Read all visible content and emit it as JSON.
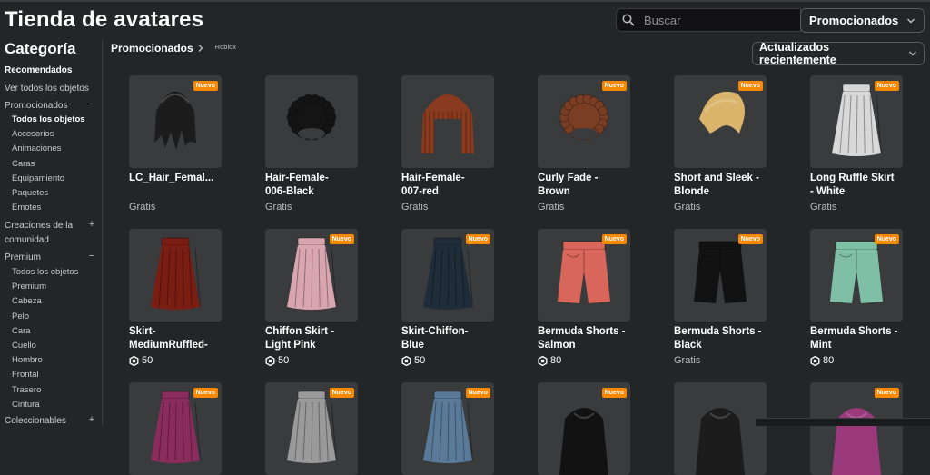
{
  "page": {
    "title": "Tienda de avatares"
  },
  "search": {
    "placeholder": "Buscar"
  },
  "category_select": {
    "value": "Promocionados"
  },
  "breadcrumb": {
    "main": "Promocionados",
    "sub": "Roblox"
  },
  "sort_select": {
    "value": "Actualizados recientemente"
  },
  "sidebar": {
    "title": "Categoría",
    "recomendados": "Recomendados",
    "ver_todos": "Ver todos los objetos",
    "promocionados": {
      "label": "Promocionados",
      "toggle": "−"
    },
    "promocionados_items": [
      "Todos los objetos",
      "Accesorios",
      "Animaciones",
      "Caras",
      "Equipamiento",
      "Paquetes",
      "Emotes"
    ],
    "creaciones": {
      "line1": "Creaciones de la",
      "line2": "comunidad",
      "toggle": "+"
    },
    "premium": {
      "label": "Premium",
      "toggle": "−"
    },
    "premium_items": [
      "Todos los objetos",
      "Premium",
      "Cabeza",
      "Pelo",
      "Cara",
      "Cuello",
      "Hombro",
      "Frontal",
      "Trasero",
      "Cintura"
    ],
    "coleccionables": {
      "label": "Coleccionables",
      "toggle": "+"
    }
  },
  "badge_text": "Nuevo",
  "items": [
    {
      "line1": "LC_Hair_Femal...",
      "line2": "",
      "price": "Gratis",
      "robux": false,
      "new": true,
      "kind": "hair",
      "color": "#1c1c1c"
    },
    {
      "line1": "Hair-Female-",
      "line2": "006-Black",
      "price": "Gratis",
      "robux": false,
      "new": false,
      "kind": "curly",
      "color": "#141414"
    },
    {
      "line1": "Hair-Female-",
      "line2": "007-red",
      "price": "Gratis",
      "robux": false,
      "new": false,
      "kind": "braids",
      "color": "#8a3a1e"
    },
    {
      "line1": "Curly Fade -",
      "line2": "Brown",
      "price": "Gratis",
      "robux": false,
      "new": true,
      "kind": "curly",
      "color": "#7a3e24"
    },
    {
      "line1": "Short and Sleek -",
      "line2": "Blonde",
      "price": "Gratis",
      "robux": false,
      "new": true,
      "kind": "sleek",
      "color": "#d9b46a"
    },
    {
      "line1": "Long Ruffle Skirt",
      "line2": "- White",
      "price": "Gratis",
      "robux": false,
      "new": true,
      "kind": "skirt",
      "color": "#d8d8d8"
    },
    {
      "line1": "Skirt-",
      "line2": "MediumRuffled-",
      "price": "50",
      "robux": true,
      "new": false,
      "kind": "skirt",
      "color": "#7a1e14"
    },
    {
      "line1": "Chiffon Skirt -",
      "line2": "Light Pink",
      "price": "50",
      "robux": true,
      "new": true,
      "kind": "skirt",
      "color": "#d9a6b0"
    },
    {
      "line1": "Skirt-Chiffon-",
      "line2": "Blue",
      "price": "50",
      "robux": true,
      "new": true,
      "kind": "skirt",
      "color": "#1f2c3a"
    },
    {
      "line1": "Bermuda Shorts -",
      "line2": "Salmon",
      "price": "80",
      "robux": true,
      "new": true,
      "kind": "shorts",
      "color": "#d9665a"
    },
    {
      "line1": "Bermuda Shorts -",
      "line2": "Black",
      "price": "Gratis",
      "robux": false,
      "new": true,
      "kind": "shorts",
      "color": "#121212"
    },
    {
      "line1": "Bermuda Shorts -",
      "line2": "Mint",
      "price": "80",
      "robux": true,
      "new": true,
      "kind": "shorts",
      "color": "#7fbfa6"
    },
    {
      "line1": "",
      "line2": "",
      "price": "",
      "robux": false,
      "new": true,
      "kind": "skirt",
      "color": "#8a2d5c"
    },
    {
      "line1": "",
      "line2": "",
      "price": "",
      "robux": false,
      "new": true,
      "kind": "skirt",
      "color": "#9a9a9a"
    },
    {
      "line1": "",
      "line2": "",
      "price": "",
      "robux": false,
      "new": true,
      "kind": "skirt",
      "color": "#5a7a9a"
    },
    {
      "line1": "",
      "line2": "",
      "price": "",
      "robux": false,
      "new": true,
      "kind": "top",
      "color": "#121212"
    },
    {
      "line1": "",
      "line2": "",
      "price": "",
      "robux": false,
      "new": false,
      "kind": "top",
      "color": "#1c1c1c"
    },
    {
      "line1": "",
      "line2": "",
      "price": "",
      "robux": false,
      "new": true,
      "kind": "top",
      "color": "#9a3a7a"
    }
  ]
}
